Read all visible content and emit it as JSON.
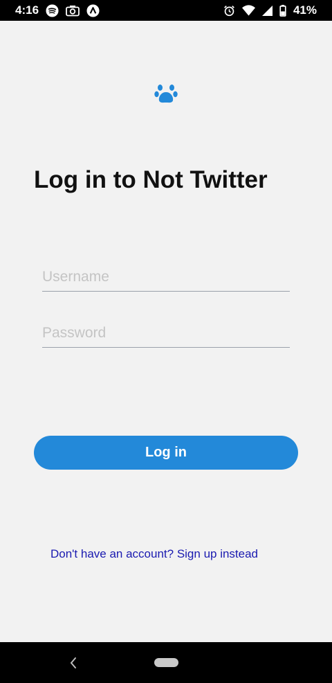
{
  "status_bar": {
    "time": "4:16",
    "battery_percent": "41%",
    "left_icons": [
      "spotify-icon",
      "camera-icon",
      "notification-app-icon"
    ],
    "right_icons": [
      "alarm-icon",
      "wifi-icon",
      "signal-icon",
      "battery-icon"
    ]
  },
  "app": {
    "logo_icon": "paw-icon",
    "accent_color": "#2389d9",
    "title": "Log in to Not Twitter"
  },
  "form": {
    "username_placeholder": "Username",
    "username_value": "",
    "password_placeholder": "Password",
    "password_value": "",
    "login_label": "Log in"
  },
  "footer": {
    "signup_link": "Don't have an account? Sign up instead"
  },
  "nav_bar": {
    "icons": [
      "back-icon",
      "home-pill-icon"
    ]
  }
}
